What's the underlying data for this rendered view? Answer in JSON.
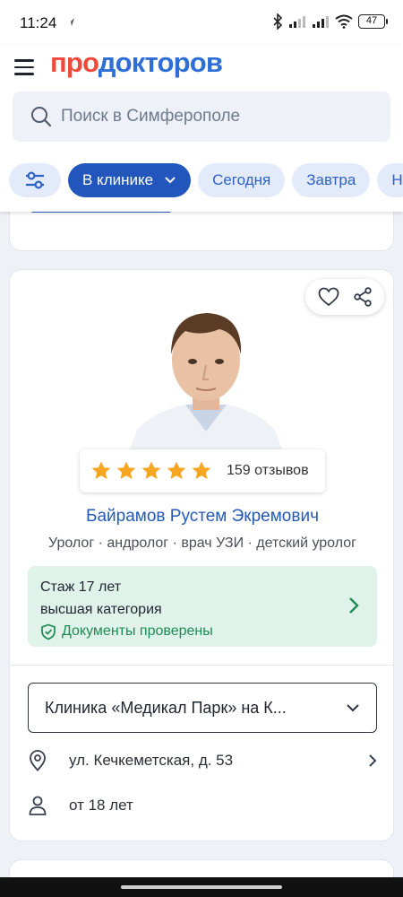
{
  "status_bar": {
    "time": "11:24",
    "battery": "47"
  },
  "header": {
    "logo_part1": "про",
    "logo_part2": "докторов",
    "search_placeholder": "Поиск в Симферополе"
  },
  "filters": {
    "active_chip": "В клинике",
    "chips": [
      "Сегодня",
      "Завтра",
      "Н"
    ]
  },
  "doctor_card": {
    "rating_stars": 5,
    "reviews_label": "159 отзывов",
    "name": "Байрамов Рустем Экремович",
    "specialties": "Уролог · андролог · врач УЗИ · детский уролог",
    "experience": "Стаж 17 лет",
    "category": "высшая категория",
    "verified": "Документы проверены",
    "clinic": "Клиника «Медикал Парк» на К...",
    "address": "ул. Кечкеметская, д. 53",
    "age": "от 18 лет"
  },
  "colors": {
    "brand_red": "#ef4a3c",
    "brand_blue": "#2e6ed6",
    "star": "#f5a623",
    "verified_green": "#1f8a55"
  }
}
